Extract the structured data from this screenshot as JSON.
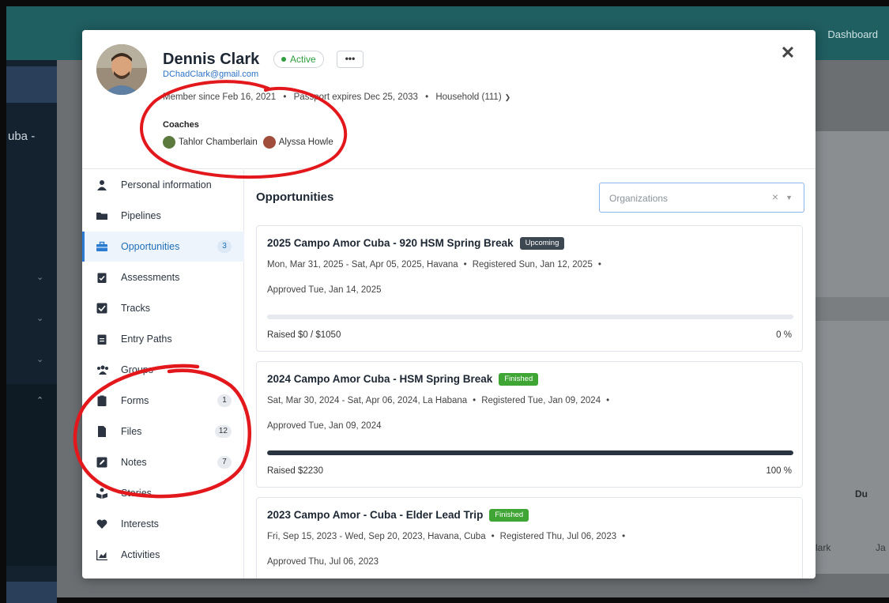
{
  "background": {
    "topbar_right": "Dashboard",
    "sidebar_text": "uba -",
    "right_header": "Du",
    "right_cell1": "lark",
    "right_cell2": "Ja"
  },
  "profile": {
    "name": "Dennis Clark",
    "status": "Active",
    "more_label": "•••",
    "email": "DChadClark@gmail.com",
    "member_since": "Member since Feb 16, 2021",
    "passport": "Passport expires Dec 25, 2033",
    "household": "Household (111)",
    "coaches_label": "Coaches",
    "coaches": [
      "Tahlor Chamberlain",
      "Alyssa Howle"
    ]
  },
  "nav": [
    {
      "label": "Personal information",
      "icon": "person-icon"
    },
    {
      "label": "Pipelines",
      "icon": "folder-icon"
    },
    {
      "label": "Opportunities",
      "icon": "briefcase-icon",
      "count": "3",
      "active": true
    },
    {
      "label": "Assessments",
      "icon": "clipboard-check-icon"
    },
    {
      "label": "Tracks",
      "icon": "checkbox-icon"
    },
    {
      "label": "Entry Paths",
      "icon": "clipboard-icon"
    },
    {
      "label": "Groups",
      "icon": "users-icon"
    },
    {
      "label": "Forms",
      "icon": "form-icon",
      "count": "1"
    },
    {
      "label": "Files",
      "icon": "file-icon",
      "count": "12"
    },
    {
      "label": "Notes",
      "icon": "note-edit-icon",
      "count": "7"
    },
    {
      "label": "Stories",
      "icon": "book-reader-icon"
    },
    {
      "label": "Interests",
      "icon": "heart-icon"
    },
    {
      "label": "Activities",
      "icon": "chart-icon"
    }
  ],
  "main": {
    "title": "Opportunities",
    "org_placeholder": "Organizations",
    "opportunities": [
      {
        "title": "2025 Campo Amor Cuba - 920 HSM Spring Break",
        "badge": "Upcoming",
        "badge_color": "#3d4752",
        "dates": "Mon, Mar 31, 2025 - Sat, Apr 05, 2025, Havana",
        "registered": "Registered Sun, Jan 12, 2025",
        "approved": "Approved Tue, Jan 14, 2025",
        "raised": "Raised $0 / $1050",
        "percent_text": "0 %",
        "progress": 0
      },
      {
        "title": "2024 Campo Amor Cuba - HSM Spring Break",
        "badge": "Finished",
        "badge_color": "#3fa535",
        "dates": "Sat, Mar 30, 2024 - Sat, Apr 06, 2024, La Habana",
        "registered": "Registered Tue, Jan 09, 2024",
        "approved": "Approved Tue, Jan 09, 2024",
        "raised": "Raised $2230",
        "percent_text": "100 %",
        "progress": 100
      },
      {
        "title": "2023 Campo Amor - Cuba - Elder Lead Trip",
        "badge": "Finished",
        "badge_color": "#3fa535",
        "dates": "Fri, Sep 15, 2023 - Wed, Sep 20, 2023, Havana, Cuba",
        "registered": "Registered Thu, Jul 06, 2023",
        "approved": "Approved Thu, Jul 06, 2023"
      }
    ]
  },
  "colors": {
    "accent": "#2a7bd1",
    "annotation": "#e3181c"
  }
}
